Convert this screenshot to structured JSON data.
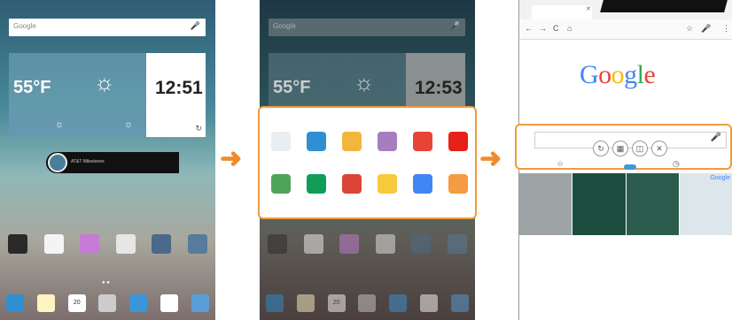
{
  "panel1": {
    "search": {
      "placeholder": "Google",
      "mic": "🎤"
    },
    "weather": {
      "temp": "55°F",
      "sun": "☼",
      "small1": "☼",
      "small2": "☼"
    },
    "clock": {
      "time": "12:51",
      "refresh": "↻"
    },
    "att": {
      "text": "AT&T Milestones"
    },
    "apps": [
      {
        "name": "pen",
        "color": "#2a2a2a"
      },
      {
        "name": "amazon",
        "color": "#f4f4f4"
      },
      {
        "name": "gallery",
        "color": "#c47bd4"
      },
      {
        "name": "play-store",
        "color": "#e6e6e6"
      },
      {
        "name": "folder-round",
        "color": "#4b6a8a"
      },
      {
        "name": "folder-grid",
        "color": "#567b9c"
      }
    ],
    "dock": [
      {
        "name": "contacts",
        "color": "#2f8fd1"
      },
      {
        "name": "email",
        "color": "#fff3c2"
      },
      {
        "name": "calendar",
        "color": "#ffffff",
        "label": "20"
      },
      {
        "name": "apps",
        "color": "#cccccc"
      },
      {
        "name": "globe",
        "color": "#3a96d8"
      },
      {
        "name": "camera",
        "color": "#ffffff"
      },
      {
        "name": "settings",
        "color": "#5a9ed8"
      }
    ]
  },
  "panel2": {
    "search": {
      "placeholder": "Google",
      "mic": "🎤"
    },
    "weather": {
      "temp": "55°F",
      "sun": "☼"
    },
    "clock": {
      "time": "12:53"
    },
    "overlay_apps": [
      {
        "name": "blank",
        "color": "#e8eef2"
      },
      {
        "name": "globe",
        "color": "#2f8fd1"
      },
      {
        "name": "email",
        "color": "#f2b63c"
      },
      {
        "name": "gallery",
        "color": "#a67ec0"
      },
      {
        "name": "chrome",
        "color": "#e84436"
      },
      {
        "name": "youtube",
        "color": "#e62117"
      },
      {
        "name": "maps",
        "color": "#4ea55a"
      },
      {
        "name": "hangouts",
        "color": "#0f9d58"
      },
      {
        "name": "gmail",
        "color": "#db4437"
      },
      {
        "name": "keep",
        "color": "#f7c93d"
      },
      {
        "name": "sketch",
        "color": "#4285f4"
      },
      {
        "name": "photos",
        "color": "#f59b42"
      }
    ]
  },
  "panel3": {
    "url_icons": {
      "back": "←",
      "forward": "→",
      "reload": "C",
      "home": "⌂",
      "star": "☆",
      "mic": "🎤",
      "menu": "⋮"
    },
    "google": {
      "letters": [
        {
          "ch": "G",
          "color": "#4285f4"
        },
        {
          "ch": "o",
          "color": "#ea4335"
        },
        {
          "ch": "o",
          "color": "#fbbc05"
        },
        {
          "ch": "g",
          "color": "#4285f4"
        },
        {
          "ch": "l",
          "color": "#34a853"
        },
        {
          "ch": "e",
          "color": "#ea4335"
        }
      ]
    },
    "overlay": {
      "mic": "🎤",
      "star": "☆",
      "clock": "◷",
      "controls": [
        "↻",
        "▦",
        "◫",
        "✕"
      ]
    },
    "thumb_text": "Google"
  },
  "arrows": [
    "➜",
    "➜"
  ]
}
